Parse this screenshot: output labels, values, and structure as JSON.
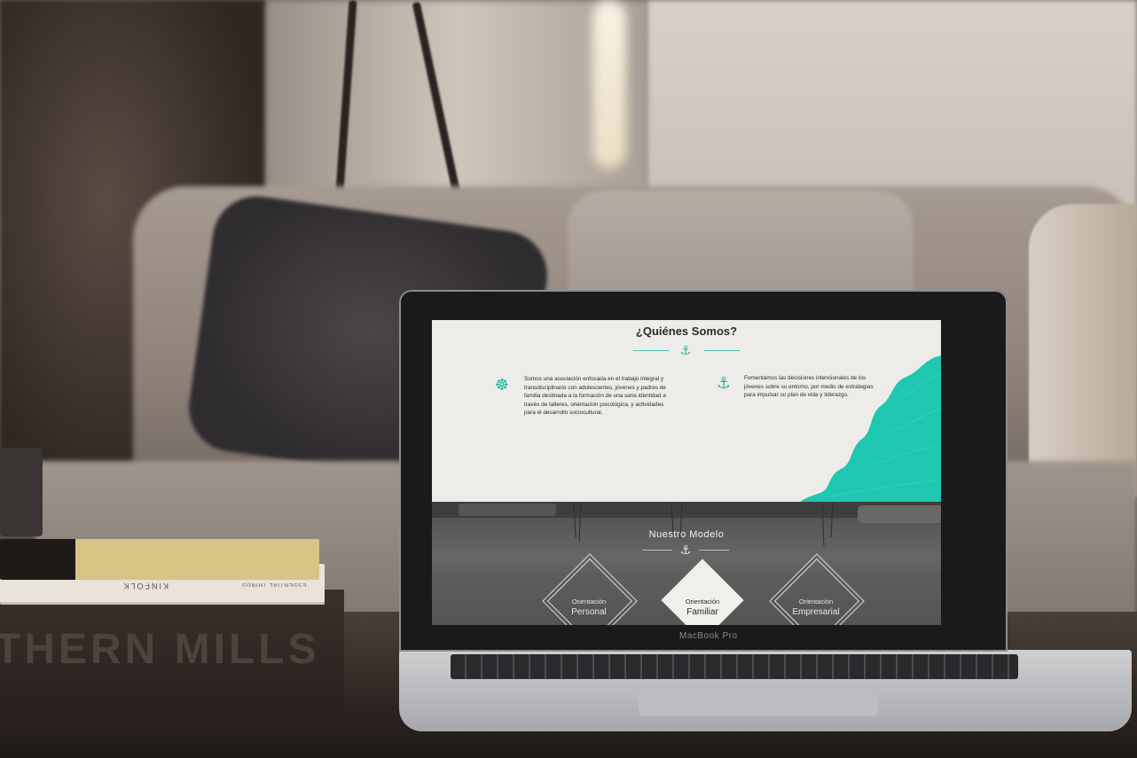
{
  "laptop": {
    "brand_label": "MacBook Pro"
  },
  "books": {
    "spine_top": "KINFOLK",
    "spine_small": "ESSENTIAL THINGS",
    "crate_text": "THERN MILLS"
  },
  "website": {
    "about": {
      "heading": "¿Quiénes Somos?",
      "col_left_icon": "ship-wheel-icon",
      "col_left_text": "Somos una asociación enfocada en el trabajo integral y transdisciplinario con adolescentes, jóvenes y padres de familia destinada a la formación de una sana identidad a través de talleres, orientación psicológica, y actividades para el desarrollo sociocultural.",
      "col_right_icon": "anchor-icon",
      "col_right_text": "Fomentamos las decisiones intencionales de los jóvenes sobre su entorno, por medio de estrategias para impulsar su plan de vida y liderazgo.",
      "accent_color": "#1fc7b1"
    },
    "model": {
      "heading": "Nuestro Modelo",
      "items": [
        {
          "small": "Orientación",
          "big": "Personal",
          "style": "outline"
        },
        {
          "small": "Orientación",
          "big": "Familiar",
          "style": "filled"
        },
        {
          "small": "Orientación",
          "big": "Empresarial",
          "style": "outline"
        }
      ]
    }
  }
}
